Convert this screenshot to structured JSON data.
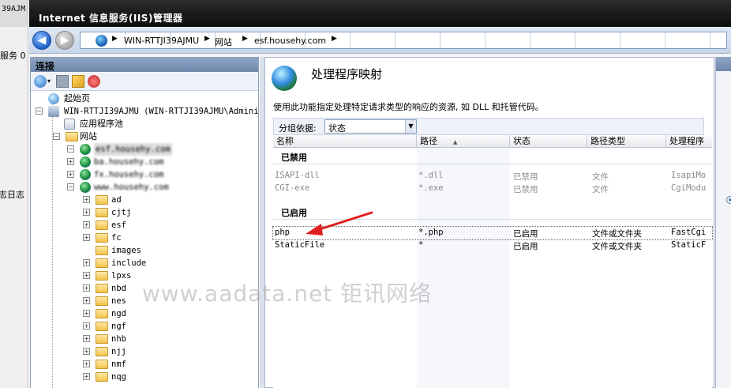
{
  "background_window": {
    "title_fragment": "39AJM",
    "text_1": "服务 0",
    "text_2": "志日志"
  },
  "window": {
    "title": "Internet 信息服务(IIS)管理器"
  },
  "address_bar": {
    "crumbs": [
      "WIN-RTTJI39AJMU",
      "网站",
      "esf.househy.com"
    ]
  },
  "connections": {
    "header": "连接",
    "tree": {
      "start_page": "起始页",
      "server": "WIN-RTTJI39AJMU (WIN-RTTJI39AJMU\\Administ",
      "app_pools": "应用程序池",
      "sites": "网站",
      "site_items": [
        "esf.househy.com",
        "ba.househy.com",
        "fx.househy.com",
        "www.househy.com"
      ],
      "folders": [
        "ad",
        "cjtj",
        "esf",
        "fc",
        "images",
        "include",
        "lpxs",
        "nbd",
        "nes",
        "ngd",
        "ngf",
        "nhb",
        "njj",
        "nmf",
        "nqg"
      ]
    }
  },
  "main": {
    "title": "处理程序映射",
    "description": "使用此功能指定处理特定请求类型的响应的资源, 如 DLL 和托管代码。",
    "group_by_label": "分组依据:",
    "group_by_value": "状态",
    "columns": [
      "名称",
      "路径",
      "状态",
      "路径类型",
      "处理程序"
    ],
    "groups": [
      {
        "label": "已禁用",
        "rows": [
          {
            "name": "ISAPI-dll",
            "path": "*.dll",
            "state": "已禁用",
            "path_type": "文件",
            "handler": "IsapiMo"
          },
          {
            "name": "CGI-exe",
            "path": "*.exe",
            "state": "已禁用",
            "path_type": "文件",
            "handler": "CgiModu"
          }
        ]
      },
      {
        "label": "已启用",
        "rows": [
          {
            "name": "php",
            "path": "*.php",
            "state": "已启用",
            "path_type": "文件或文件夹",
            "handler": "FastCgi"
          },
          {
            "name": "StaticFile",
            "path": "*",
            "state": "已启用",
            "path_type": "文件或文件夹",
            "handler": "StaticF"
          }
        ]
      }
    ]
  },
  "watermark": "www.aadata.net 钜讯网络",
  "colors": {
    "titlebar": "#141414",
    "panel_header": "#7a92b4",
    "annotation_arrow": "#e02020",
    "disabled_text": "#8a8a8a"
  }
}
